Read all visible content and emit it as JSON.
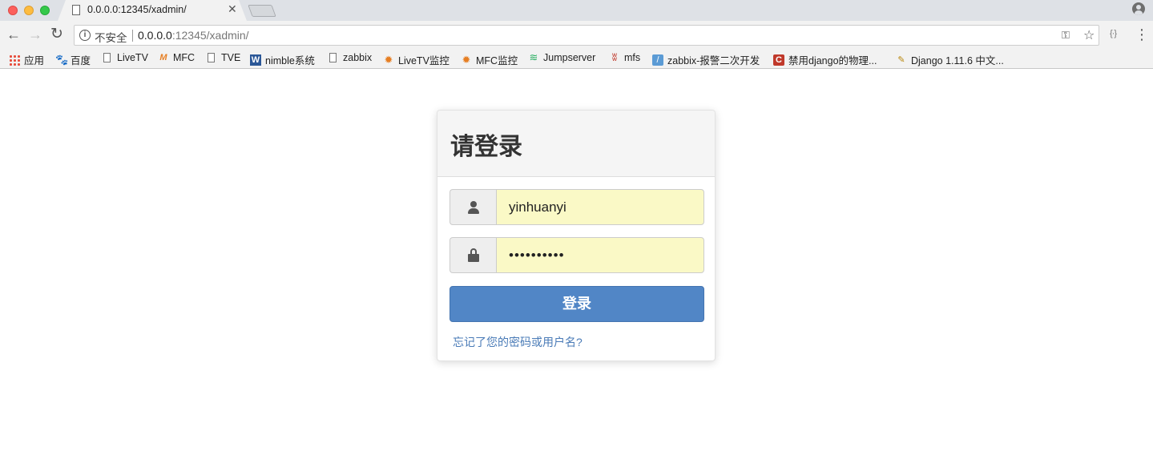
{
  "browser": {
    "tab_title": "0.0.0.0:12345/xadmin/",
    "security_label": "不安全",
    "url_host": "0.0.0.0",
    "url_path": ":12345/xadmin/"
  },
  "bookmarks": [
    {
      "label": "应用",
      "icon": "apps-grid-icon"
    },
    {
      "label": "百度",
      "icon": "paw-icon"
    },
    {
      "label": "LiveTV",
      "icon": "page-icon"
    },
    {
      "label": "MFC",
      "icon": "mfc-icon"
    },
    {
      "label": "TVE",
      "icon": "page-icon"
    },
    {
      "label": "nimble系统",
      "icon": "word-icon"
    },
    {
      "label": "zabbix",
      "icon": "page-icon"
    },
    {
      "label": "LiveTV监控",
      "icon": "grafana-icon"
    },
    {
      "label": "MFC监控",
      "icon": "grafana-icon"
    },
    {
      "label": "Jumpserver",
      "icon": "stack-icon"
    },
    {
      "label": "mfs",
      "icon": "mfs-icon"
    },
    {
      "label": "zabbix-报警二次开发",
      "icon": "feather-icon"
    },
    {
      "label": "禁用django的物理...",
      "icon": "csdn-icon"
    },
    {
      "label": "Django 1.11.6 中文...",
      "icon": "django-icon"
    }
  ],
  "login": {
    "title": "请登录",
    "username_value": "yinhuanyi",
    "password_value": "••••••••••",
    "submit_label": "登录",
    "forgot_link": "忘记了您的密码或用户名?"
  },
  "colors": {
    "primary_button": "#5186c6",
    "autofill_background": "#faf9c6",
    "link": "#4a7bb7"
  }
}
